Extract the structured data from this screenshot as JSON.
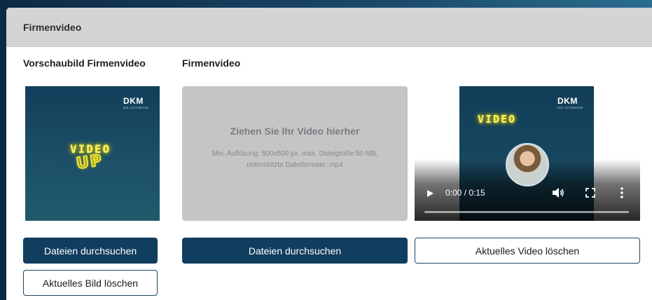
{
  "panel": {
    "title": "Firmenvideo"
  },
  "preview_column": {
    "title": "Vorschaubild Firmenvideo",
    "thumbnail": {
      "logo": "DKM",
      "logo_sub": "DIE LEITMESSE",
      "headline": "VIDEO",
      "sub_headline": "UP"
    },
    "browse_button": "Dateien durchsuchen",
    "delete_button": "Aktuelles Bild löschen"
  },
  "video_column": {
    "title": "Firmenvideo",
    "dropzone": {
      "title": "Ziehen Sie Ihr Video hierher",
      "hint": "Min. Auflösung: 500x500 px, max. Dateigröße:50 MB, unterstützte Dateiformate: mp4"
    },
    "browse_button": "Dateien durchsuchen"
  },
  "player": {
    "logo": "DKM",
    "logo_sub": "DIE LEITMESSE",
    "overlay_text": "VIDEO",
    "time": "0:00 / 0:15",
    "progress": 0,
    "delete_button": "Aktuelles Video löschen"
  },
  "colors": {
    "primary": "#113d5f",
    "header_bg": "#d3d4d5",
    "dropzone_bg": "#c4c5c6",
    "neon": "#f5e433"
  }
}
